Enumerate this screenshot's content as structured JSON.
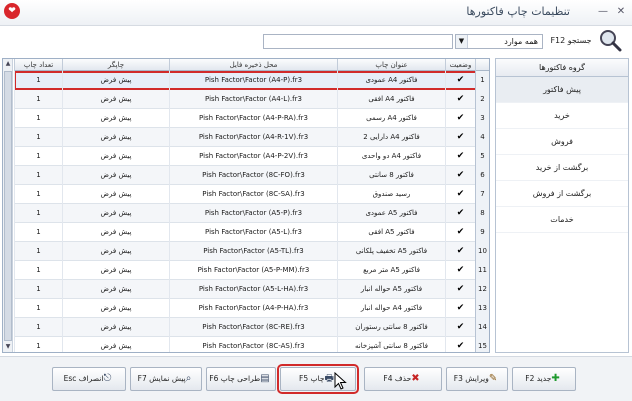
{
  "window": {
    "title": "تنظیمات چاپ فاکتورها",
    "app_icon": "❤"
  },
  "search": {
    "label": "جستجو F12",
    "combo_value": "همه موارد",
    "input_value": ""
  },
  "grid": {
    "headers": {
      "status": "وضعیت",
      "title": "عنوان چاپ",
      "path": "محل ذخیره فایل",
      "printer": "چاپگر",
      "copies": "تعداد چاپ"
    },
    "rows": [
      {
        "num": "1",
        "title": "فاکتور A4 عمودی",
        "path": "Pish Factor\\Factor (A4-P).fr3",
        "printer": "پیش فرض",
        "copies": "1"
      },
      {
        "num": "2",
        "title": "فاکتور A4 افقی",
        "path": "Pish Factor\\Factor (A4-L).fr3",
        "printer": "پیش فرض",
        "copies": "1"
      },
      {
        "num": "3",
        "title": "فاکتور A4 رسمی",
        "path": "Pish Factor\\Factor (A4-P-RA).fr3",
        "printer": "پیش فرض",
        "copies": "1"
      },
      {
        "num": "4",
        "title": "فاکتور A4 دارایی 2",
        "path": "Pish Factor\\Factor (A4-R-1V).fr3",
        "printer": "پیش فرض",
        "copies": "1"
      },
      {
        "num": "5",
        "title": "فاکتور A4 دو واحدی",
        "path": "Pish Factor\\Factor (A4-P-2V).fr3",
        "printer": "پیش فرض",
        "copies": "1"
      },
      {
        "num": "6",
        "title": "فاکتور 8 سانتی",
        "path": "Pish Factor\\Factor (8C-FO).fr3",
        "printer": "پیش فرض",
        "copies": "1"
      },
      {
        "num": "7",
        "title": "رسید صندوق",
        "path": "Pish Factor\\Factor (8C-SA).fr3",
        "printer": "پیش فرض",
        "copies": "1"
      },
      {
        "num": "8",
        "title": "فاکتور A5 عمودی",
        "path": "Pish Factor\\Factor (A5-P).fr3",
        "printer": "پیش فرض",
        "copies": "1"
      },
      {
        "num": "9",
        "title": "فاکتور A5 افقی",
        "path": "Pish Factor\\Factor (A5-L).fr3",
        "printer": "پیش فرض",
        "copies": "1"
      },
      {
        "num": "10",
        "title": "فاکتور A5 تخفیف پلکانی",
        "path": "Pish Factor\\Factor (A5-TL).fr3",
        "printer": "پیش فرض",
        "copies": "1"
      },
      {
        "num": "11",
        "title": "فاکتور A5 متر مربع",
        "path": "Pish Factor\\Factor (A5-P-MM).fr3",
        "printer": "پیش فرض",
        "copies": "1"
      },
      {
        "num": "12",
        "title": "فاکتور A5 حواله انبار",
        "path": "Pish Factor\\Factor (A5-L-HA).fr3",
        "printer": "پیش فرض",
        "copies": "1"
      },
      {
        "num": "13",
        "title": "فاکتور A4 حواله انبار",
        "path": "Pish Factor\\Factor (A4-P-HA).fr3",
        "printer": "پیش فرض",
        "copies": "1"
      },
      {
        "num": "14",
        "title": "فاکتور 8 سانتی رستوران",
        "path": "Pish Factor\\Factor (8C-RE).fr3",
        "printer": "پیش فرض",
        "copies": "1"
      },
      {
        "num": "15",
        "title": "فاکتور 8 سانتی آشپزخانه",
        "path": "Pish Factor\\Factor (8C-AS).fr3",
        "printer": "پیش فرض",
        "copies": "1"
      }
    ]
  },
  "sidebar": {
    "title": "گروه فاکتورها",
    "items": [
      "پیش فاکتور",
      "خرید",
      "فروش",
      "برگشت از خرید",
      "برگشت از فروش",
      "خدمات"
    ]
  },
  "toolbar": {
    "new": "جدید F2",
    "edit": "ویرایش F3",
    "delete": "حذف F4",
    "print": "چاپ F5",
    "design": "طراحی چاپ F6",
    "preview": "پیش نمایش F7",
    "cancel": "انصراف Esc"
  },
  "colors": {
    "highlight": "#d12a2a",
    "accent": "#2c6fb7"
  }
}
